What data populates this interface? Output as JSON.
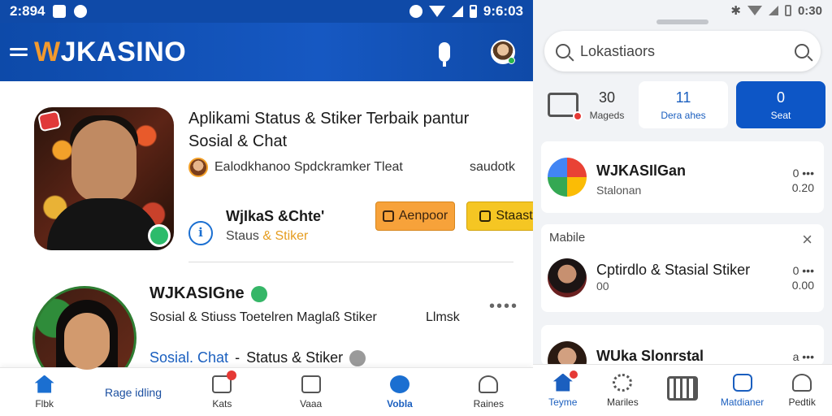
{
  "left": {
    "status_bar": {
      "time": "2:894",
      "right_time": "9:6:03"
    },
    "app_bar": {
      "logo_part1": "W",
      "logo_part2": "JKASINO"
    },
    "card1": {
      "title": "Aplikami Status & Stiker Terbaik pantur Sosial & Chat",
      "row2_left": "Ealodkhanoo Spdckramker Tleat",
      "row2_right": "saudotk",
      "name": "WjIkaS &Chte'",
      "sub_normal": "Staus ",
      "sub_accent": "& Stiker",
      "btn_orange": "Aenpoor",
      "btn_yellow": "Staast"
    },
    "card2": {
      "name": "WJKASIGne",
      "desc": "Sosial & Stiuss Toetelren Maglaß Stiker",
      "link": "Llmsk",
      "dots": "••••",
      "tag_blue": "Sosial. Chat",
      "tag_sep": "-",
      "tag_rest": "Status & Stiker"
    },
    "bottom_nav": [
      {
        "label": "Flbk",
        "icon": "home-icon"
      },
      {
        "label": "Rage idling",
        "icon": ""
      },
      {
        "label": "Kats",
        "icon": "inbox-icon"
      },
      {
        "label": "Vaaa",
        "icon": "camera-icon"
      },
      {
        "label": "Vobla",
        "icon": "compass-icon"
      },
      {
        "label": "Raines",
        "icon": "person-icon"
      }
    ]
  },
  "right": {
    "status_bar": {
      "time": "0:30"
    },
    "search": {
      "placeholder": "Lokastiaors"
    },
    "stats": [
      {
        "num": "30",
        "label": "Mageds"
      },
      {
        "num": "11",
        "label": "Dera ahes"
      },
      {
        "num": "0",
        "label": "Seat"
      }
    ],
    "card1": {
      "title": "WJKASIlGan",
      "sub": "Stalonan",
      "meta1": "0 •••",
      "meta2": "0.20"
    },
    "card2": {
      "header": "Mabile",
      "close": "×",
      "title": "Cptirdlo & Stasial Stiker",
      "sub": "00",
      "meta1": "0 •••",
      "meta2": "0.00"
    },
    "card3": {
      "title": "WUka Slonrstal",
      "meta1": "a •••"
    },
    "nav": [
      {
        "label": "Teyme"
      },
      {
        "label": "Mariles"
      },
      {
        "label": ""
      },
      {
        "label": "Matdianer"
      },
      {
        "label": "Pedtik"
      }
    ]
  },
  "colors": {
    "brand_blue": "#0f4aa8",
    "logo_orange": "#f29a2e",
    "accent_blue": "#0d56c6",
    "btn_orange": "#f7a23a",
    "btn_yellow": "#f5c623"
  }
}
